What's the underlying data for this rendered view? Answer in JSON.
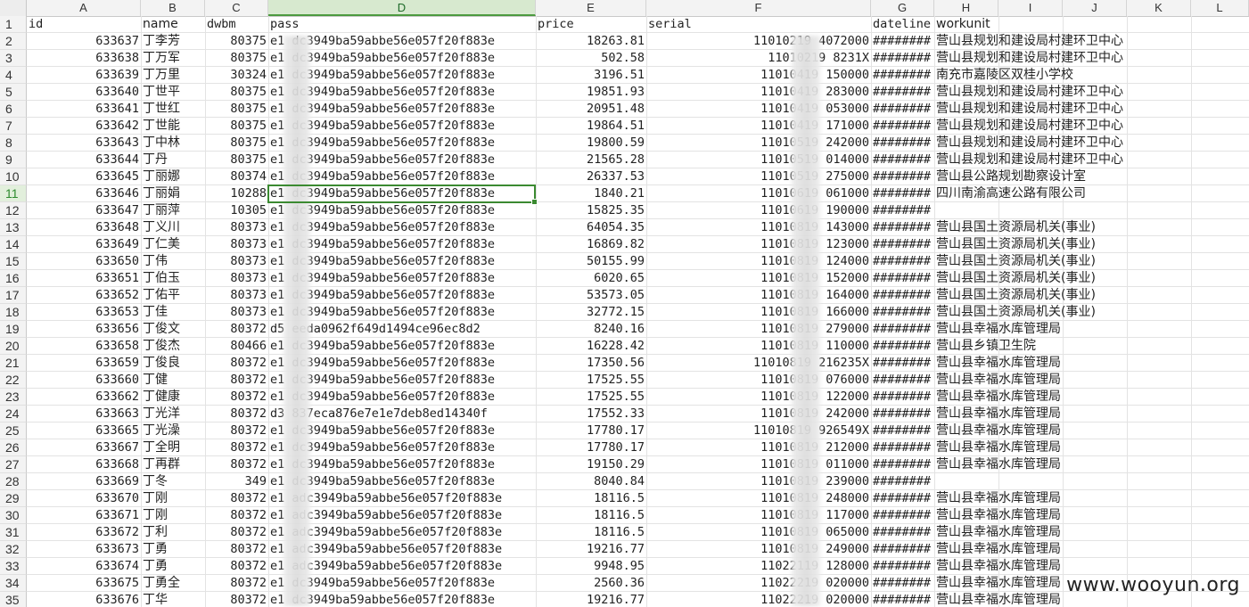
{
  "sheet": {
    "columns": [
      "A",
      "B",
      "C",
      "D",
      "E",
      "F",
      "G",
      "H",
      "I",
      "J",
      "K",
      "L"
    ],
    "active_column": "D",
    "active_row": "11",
    "header_row": {
      "row_num": "1",
      "cells": [
        "id",
        "name",
        "dwbm",
        "pass",
        "price",
        "serial",
        "dateline",
        "workunit"
      ]
    },
    "rows": [
      {
        "n": "2",
        "id": "633637",
        "name": "丁李芳",
        "dwbm": "80375",
        "pass": "e1  dc3949ba59abbe56e057f20f883e",
        "price": "18263.81",
        "serial": "11010219   4072000",
        "dateline": "########",
        "workunit": "营山县规划和建设局村建环卫中心"
      },
      {
        "n": "3",
        "id": "633638",
        "name": "丁万军",
        "dwbm": "80375",
        "pass": "e1  dc3949ba59abbe56e057f20f883e",
        "price": "502.58",
        "serial": "11010219   8231X",
        "dateline": "########",
        "workunit": "营山县规划和建设局村建环卫中心"
      },
      {
        "n": "4",
        "id": "633639",
        "name": "丁万里",
        "dwbm": "30324",
        "pass": "e1  dc3949ba59abbe56e057f20f883e",
        "price": "3196.51",
        "serial": "11010419   150000",
        "dateline": "########",
        "workunit": "南充市嘉陵区双桂小学校"
      },
      {
        "n": "5",
        "id": "633640",
        "name": "丁世平",
        "dwbm": "80375",
        "pass": "e1  dc3949ba59abbe56e057f20f883e",
        "price": "19851.93",
        "serial": "11010419   283000",
        "dateline": "########",
        "workunit": "营山县规划和建设局村建环卫中心"
      },
      {
        "n": "6",
        "id": "633641",
        "name": "丁世红",
        "dwbm": "80375",
        "pass": "e1  dc3949ba59abbe56e057f20f883e",
        "price": "20951.48",
        "serial": "11010419   053000",
        "dateline": "########",
        "workunit": "营山县规划和建设局村建环卫中心"
      },
      {
        "n": "7",
        "id": "633642",
        "name": "丁世能",
        "dwbm": "80375",
        "pass": "e1  dc3949ba59abbe56e057f20f883e",
        "price": "19864.51",
        "serial": "11010419   171000",
        "dateline": "########",
        "workunit": "营山县规划和建设局村建环卫中心"
      },
      {
        "n": "8",
        "id": "633643",
        "name": "丁中林",
        "dwbm": "80375",
        "pass": "e1  dc3949ba59abbe56e057f20f883e",
        "price": "19800.59",
        "serial": "11010519   242000",
        "dateline": "########",
        "workunit": "营山县规划和建设局村建环卫中心"
      },
      {
        "n": "9",
        "id": "633644",
        "name": "丁丹",
        "dwbm": "80375",
        "pass": "e1  dc3949ba59abbe56e057f20f883e",
        "price": "21565.28",
        "serial": "11010519   014000",
        "dateline": "########",
        "workunit": "营山县规划和建设局村建环卫中心"
      },
      {
        "n": "10",
        "id": "633645",
        "name": "丁丽娜",
        "dwbm": "80374",
        "pass": "e1  dc3949ba59abbe56e057f20f883e",
        "price": "26337.53",
        "serial": "11010519   275000",
        "dateline": "########",
        "workunit": "营山县公路规划勘察设计室"
      },
      {
        "n": "11",
        "id": "633646",
        "name": "丁丽娟",
        "dwbm": "10288",
        "pass": "e1  dc3949ba59abbe56e057f20f883e",
        "price": "1840.21",
        "serial": "11010619   061000",
        "dateline": "########",
        "workunit": "四川南渝高速公路有限公司"
      },
      {
        "n": "12",
        "id": "633647",
        "name": "丁丽萍",
        "dwbm": "10305",
        "pass": "e1  dc3949ba59abbe56e057f20f883e",
        "price": "15825.35",
        "serial": "11010619   190000",
        "dateline": "########",
        "workunit": ""
      },
      {
        "n": "13",
        "id": "633648",
        "name": "丁义川",
        "dwbm": "80373",
        "pass": "e1  dc3949ba59abbe56e057f20f883e",
        "price": "64054.35",
        "serial": "11010819   143000",
        "dateline": "########",
        "workunit": "营山县国土资源局机关(事业)"
      },
      {
        "n": "14",
        "id": "633649",
        "name": "丁仁美",
        "dwbm": "80373",
        "pass": "e1  dc3949ba59abbe56e057f20f883e",
        "price": "16869.82",
        "serial": "11010819   123000",
        "dateline": "########",
        "workunit": "营山县国土资源局机关(事业)"
      },
      {
        "n": "15",
        "id": "633650",
        "name": "丁伟",
        "dwbm": "80373",
        "pass": "e1  dc3949ba59abbe56e057f20f883e",
        "price": "50155.99",
        "serial": "11010819   124000",
        "dateline": "########",
        "workunit": "营山县国土资源局机关(事业)"
      },
      {
        "n": "16",
        "id": "633651",
        "name": "丁伯玉",
        "dwbm": "80373",
        "pass": "e1  dc3949ba59abbe56e057f20f883e",
        "price": "6020.65",
        "serial": "11010819   152000",
        "dateline": "########",
        "workunit": "营山县国土资源局机关(事业)"
      },
      {
        "n": "17",
        "id": "633652",
        "name": "丁佑平",
        "dwbm": "80373",
        "pass": "e1  dc3949ba59abbe56e057f20f883e",
        "price": "53573.05",
        "serial": "11010819   164000",
        "dateline": "########",
        "workunit": "营山县国土资源局机关(事业)"
      },
      {
        "n": "18",
        "id": "633653",
        "name": "丁佳",
        "dwbm": "80373",
        "pass": "e1  dc3949ba59abbe56e057f20f883e",
        "price": "32772.15",
        "serial": "11010819   166000",
        "dateline": "########",
        "workunit": "营山县国土资源局机关(事业)"
      },
      {
        "n": "19",
        "id": "633656",
        "name": "丁俊文",
        "dwbm": "80372",
        "pass": "d5  eeda0962f649d1494ce96ec8d2",
        "price": "8240.16",
        "serial": "11010819   279000",
        "dateline": "########",
        "workunit": "营山县幸福水库管理局"
      },
      {
        "n": "20",
        "id": "633658",
        "name": "丁俊杰",
        "dwbm": "80466",
        "pass": "e1  dc3949ba59abbe56e057f20f883e",
        "price": "16228.42",
        "serial": "11010819   110000",
        "dateline": "########",
        "workunit": "营山县乡镇卫生院"
      },
      {
        "n": "21",
        "id": "633659",
        "name": "丁俊良",
        "dwbm": "80372",
        "pass": "e1  dc3949ba59abbe56e057f20f883e",
        "price": "17350.56",
        "serial": "11010819   216235X",
        "dateline": "########",
        "workunit": "营山县幸福水库管理局"
      },
      {
        "n": "22",
        "id": "633660",
        "name": "丁健",
        "dwbm": "80372",
        "pass": "e1  dc3949ba59abbe56e057f20f883e",
        "price": "17525.55",
        "serial": "11010819   076000",
        "dateline": "########",
        "workunit": "营山县幸福水库管理局"
      },
      {
        "n": "23",
        "id": "633662",
        "name": "丁健康",
        "dwbm": "80372",
        "pass": "e1  dc3949ba59abbe56e057f20f883e",
        "price": "17525.55",
        "serial": "11010819   122000",
        "dateline": "########",
        "workunit": "营山县幸福水库管理局"
      },
      {
        "n": "24",
        "id": "633663",
        "name": "丁光洋",
        "dwbm": "80372",
        "pass": "d3  837eca876e7e1e7deb8ed14340f",
        "price": "17552.33",
        "serial": "11010819   242000",
        "dateline": "########",
        "workunit": "营山县幸福水库管理局"
      },
      {
        "n": "25",
        "id": "633665",
        "name": "丁光澡",
        "dwbm": "80372",
        "pass": "e1  dc3949ba59abbe56e057f20f883e",
        "price": "17780.17",
        "serial": "11010819   926549X",
        "dateline": "########",
        "workunit": "营山县幸福水库管理局"
      },
      {
        "n": "26",
        "id": "633667",
        "name": "丁全明",
        "dwbm": "80372",
        "pass": "e1  dc3949ba59abbe56e057f20f883e",
        "price": "17780.17",
        "serial": "11010819   212000",
        "dateline": "########",
        "workunit": "营山县幸福水库管理局"
      },
      {
        "n": "27",
        "id": "633668",
        "name": "丁再群",
        "dwbm": "80372",
        "pass": "e1  dc3949ba59abbe56e057f20f883e",
        "price": "19150.29",
        "serial": "11010819   011000",
        "dateline": "########",
        "workunit": "营山县幸福水库管理局"
      },
      {
        "n": "28",
        "id": "633669",
        "name": "丁冬",
        "dwbm": "349",
        "pass": "e1  dc3949ba59abbe56e057f20f883e",
        "price": "8040.84",
        "serial": "11010819   239000",
        "dateline": "########",
        "workunit": ""
      },
      {
        "n": "29",
        "id": "633670",
        "name": "丁刚",
        "dwbm": "80372",
        "pass": "e1  adc3949ba59abbe56e057f20f883e",
        "price": "18116.5",
        "serial": "11010819   248000",
        "dateline": "########",
        "workunit": "营山县幸福水库管理局"
      },
      {
        "n": "30",
        "id": "633671",
        "name": "丁刚",
        "dwbm": "80372",
        "pass": "e1  adc3949ba59abbe56e057f20f883e",
        "price": "18116.5",
        "serial": "11010819   117000",
        "dateline": "########",
        "workunit": "营山县幸福水库管理局"
      },
      {
        "n": "31",
        "id": "633672",
        "name": "丁利",
        "dwbm": "80372",
        "pass": "e1  adc3949ba59abbe56e057f20f883e",
        "price": "18116.5",
        "serial": "11010819   065000",
        "dateline": "########",
        "workunit": "营山县幸福水库管理局"
      },
      {
        "n": "32",
        "id": "633673",
        "name": "丁勇",
        "dwbm": "80372",
        "pass": "e1  adc3949ba59abbe56e057f20f883e",
        "price": "19216.77",
        "serial": "11010819   249000",
        "dateline": "########",
        "workunit": "营山县幸福水库管理局"
      },
      {
        "n": "33",
        "id": "633674",
        "name": "丁勇",
        "dwbm": "80372",
        "pass": "e1  adc3949ba59abbe56e057f20f883e",
        "price": "9948.95",
        "serial": "11022119   128000",
        "dateline": "########",
        "workunit": "营山县幸福水库管理局"
      },
      {
        "n": "34",
        "id": "633675",
        "name": "丁勇全",
        "dwbm": "80372",
        "pass": "e1  dc3949ba59abbe56e057f20f883e",
        "price": "2560.36",
        "serial": "11022219   020000",
        "dateline": "########",
        "workunit": "营山县幸福水库管理局"
      },
      {
        "n": "35",
        "id": "633676",
        "name": "丁华",
        "dwbm": "80372",
        "pass": "e1  dc3949ba59abbe56e057f20f883e",
        "price": "19216.77",
        "serial": "11022219   020000",
        "dateline": "########",
        "workunit": "营山县幸福水库管理局"
      }
    ]
  },
  "watermark": "www.wooyun.org",
  "colors": {
    "accent": "#3b8a31",
    "header_bg": "#f3f3f3",
    "active_header_bg": "#d7e9cf"
  }
}
